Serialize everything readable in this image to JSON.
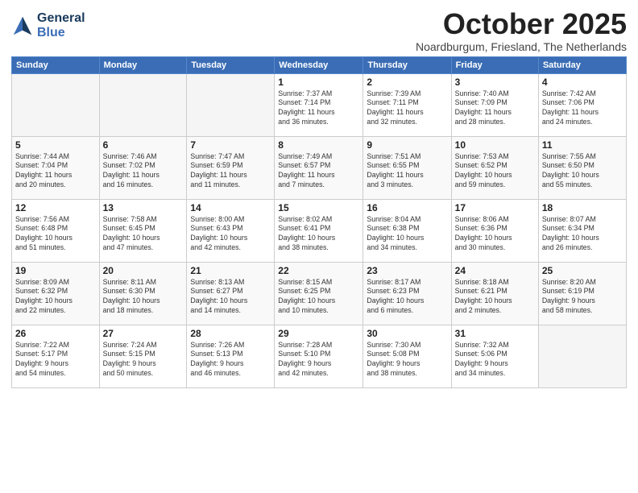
{
  "logo": {
    "line1": "General",
    "line2": "Blue"
  },
  "title": "October 2025",
  "subtitle": "Noardburgum, Friesland, The Netherlands",
  "headers": [
    "Sunday",
    "Monday",
    "Tuesday",
    "Wednesday",
    "Thursday",
    "Friday",
    "Saturday"
  ],
  "weeks": [
    [
      {
        "day": "",
        "info": ""
      },
      {
        "day": "",
        "info": ""
      },
      {
        "day": "",
        "info": ""
      },
      {
        "day": "1",
        "info": "Sunrise: 7:37 AM\nSunset: 7:14 PM\nDaylight: 11 hours\nand 36 minutes."
      },
      {
        "day": "2",
        "info": "Sunrise: 7:39 AM\nSunset: 7:11 PM\nDaylight: 11 hours\nand 32 minutes."
      },
      {
        "day": "3",
        "info": "Sunrise: 7:40 AM\nSunset: 7:09 PM\nDaylight: 11 hours\nand 28 minutes."
      },
      {
        "day": "4",
        "info": "Sunrise: 7:42 AM\nSunset: 7:06 PM\nDaylight: 11 hours\nand 24 minutes."
      }
    ],
    [
      {
        "day": "5",
        "info": "Sunrise: 7:44 AM\nSunset: 7:04 PM\nDaylight: 11 hours\nand 20 minutes."
      },
      {
        "day": "6",
        "info": "Sunrise: 7:46 AM\nSunset: 7:02 PM\nDaylight: 11 hours\nand 16 minutes."
      },
      {
        "day": "7",
        "info": "Sunrise: 7:47 AM\nSunset: 6:59 PM\nDaylight: 11 hours\nand 11 minutes."
      },
      {
        "day": "8",
        "info": "Sunrise: 7:49 AM\nSunset: 6:57 PM\nDaylight: 11 hours\nand 7 minutes."
      },
      {
        "day": "9",
        "info": "Sunrise: 7:51 AM\nSunset: 6:55 PM\nDaylight: 11 hours\nand 3 minutes."
      },
      {
        "day": "10",
        "info": "Sunrise: 7:53 AM\nSunset: 6:52 PM\nDaylight: 10 hours\nand 59 minutes."
      },
      {
        "day": "11",
        "info": "Sunrise: 7:55 AM\nSunset: 6:50 PM\nDaylight: 10 hours\nand 55 minutes."
      }
    ],
    [
      {
        "day": "12",
        "info": "Sunrise: 7:56 AM\nSunset: 6:48 PM\nDaylight: 10 hours\nand 51 minutes."
      },
      {
        "day": "13",
        "info": "Sunrise: 7:58 AM\nSunset: 6:45 PM\nDaylight: 10 hours\nand 47 minutes."
      },
      {
        "day": "14",
        "info": "Sunrise: 8:00 AM\nSunset: 6:43 PM\nDaylight: 10 hours\nand 42 minutes."
      },
      {
        "day": "15",
        "info": "Sunrise: 8:02 AM\nSunset: 6:41 PM\nDaylight: 10 hours\nand 38 minutes."
      },
      {
        "day": "16",
        "info": "Sunrise: 8:04 AM\nSunset: 6:38 PM\nDaylight: 10 hours\nand 34 minutes."
      },
      {
        "day": "17",
        "info": "Sunrise: 8:06 AM\nSunset: 6:36 PM\nDaylight: 10 hours\nand 30 minutes."
      },
      {
        "day": "18",
        "info": "Sunrise: 8:07 AM\nSunset: 6:34 PM\nDaylight: 10 hours\nand 26 minutes."
      }
    ],
    [
      {
        "day": "19",
        "info": "Sunrise: 8:09 AM\nSunset: 6:32 PM\nDaylight: 10 hours\nand 22 minutes."
      },
      {
        "day": "20",
        "info": "Sunrise: 8:11 AM\nSunset: 6:30 PM\nDaylight: 10 hours\nand 18 minutes."
      },
      {
        "day": "21",
        "info": "Sunrise: 8:13 AM\nSunset: 6:27 PM\nDaylight: 10 hours\nand 14 minutes."
      },
      {
        "day": "22",
        "info": "Sunrise: 8:15 AM\nSunset: 6:25 PM\nDaylight: 10 hours\nand 10 minutes."
      },
      {
        "day": "23",
        "info": "Sunrise: 8:17 AM\nSunset: 6:23 PM\nDaylight: 10 hours\nand 6 minutes."
      },
      {
        "day": "24",
        "info": "Sunrise: 8:18 AM\nSunset: 6:21 PM\nDaylight: 10 hours\nand 2 minutes."
      },
      {
        "day": "25",
        "info": "Sunrise: 8:20 AM\nSunset: 6:19 PM\nDaylight: 9 hours\nand 58 minutes."
      }
    ],
    [
      {
        "day": "26",
        "info": "Sunrise: 7:22 AM\nSunset: 5:17 PM\nDaylight: 9 hours\nand 54 minutes."
      },
      {
        "day": "27",
        "info": "Sunrise: 7:24 AM\nSunset: 5:15 PM\nDaylight: 9 hours\nand 50 minutes."
      },
      {
        "day": "28",
        "info": "Sunrise: 7:26 AM\nSunset: 5:13 PM\nDaylight: 9 hours\nand 46 minutes."
      },
      {
        "day": "29",
        "info": "Sunrise: 7:28 AM\nSunset: 5:10 PM\nDaylight: 9 hours\nand 42 minutes."
      },
      {
        "day": "30",
        "info": "Sunrise: 7:30 AM\nSunset: 5:08 PM\nDaylight: 9 hours\nand 38 minutes."
      },
      {
        "day": "31",
        "info": "Sunrise: 7:32 AM\nSunset: 5:06 PM\nDaylight: 9 hours\nand 34 minutes."
      },
      {
        "day": "",
        "info": ""
      }
    ]
  ]
}
